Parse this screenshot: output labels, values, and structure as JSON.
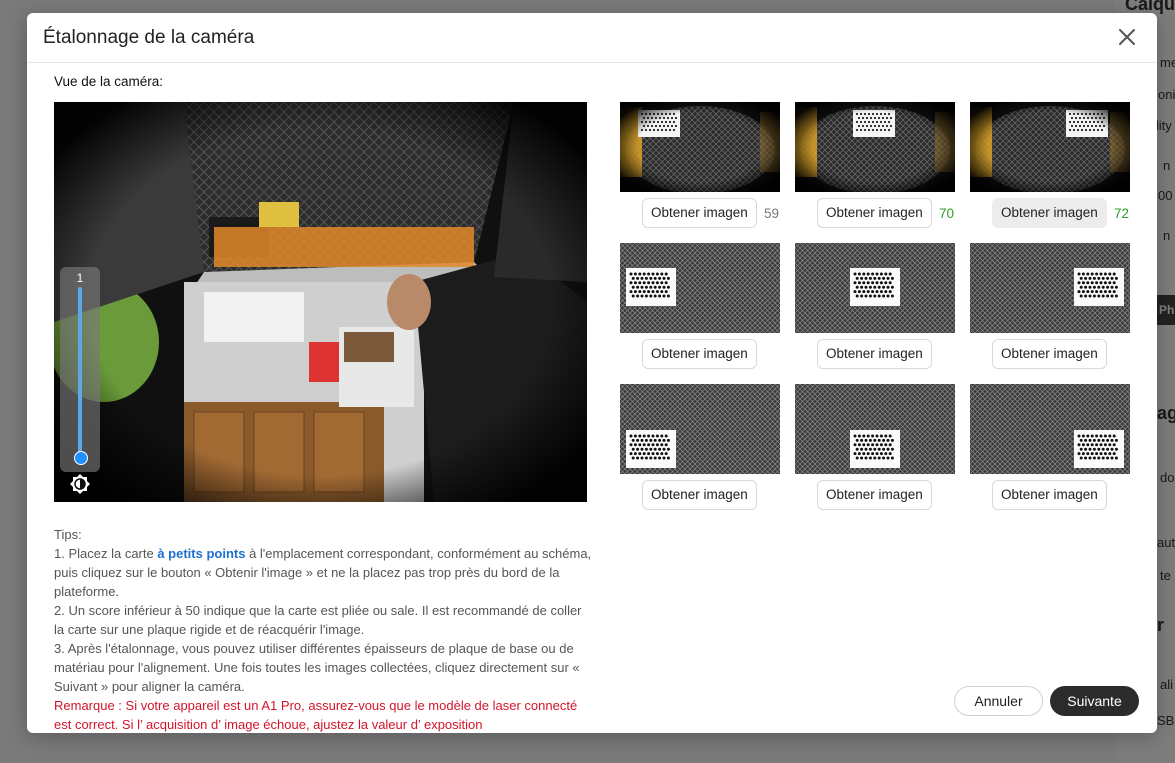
{
  "background": {
    "labels": [
      "Calque",
      "me",
      "oni",
      "ility",
      "n",
      "00",
      "n",
      "Ph",
      "ag",
      "do",
      "aut",
      "te",
      "r",
      "ali",
      "SB-"
    ]
  },
  "dialog": {
    "title": "Étalonnage de la caméra",
    "camera_label": "Vue de la caméra:",
    "exposure_value": "1",
    "capture_label": "Obtener imagen",
    "captures": [
      {
        "score": "59",
        "score_color": "#777777"
      },
      {
        "score": "70",
        "score_color": "#2a9d2a"
      },
      {
        "score": "72",
        "score_color": "#2a9d2a"
      },
      {
        "score": ""
      },
      {
        "score": ""
      },
      {
        "score": ""
      },
      {
        "score": ""
      },
      {
        "score": ""
      },
      {
        "score": ""
      }
    ],
    "tips": {
      "heading": "Tips:",
      "tip1_a": "1. Placez la carte ",
      "tip1_link": "à petits points",
      "tip1_b": " à l'emplacement correspondant, conformément au schéma, puis cliquez sur le bouton « Obtenir l'image » et ne la placez pas trop près du bord de la plateforme.",
      "tip2": "2. Un score inférieur à 50 indique que la carte est pliée ou sale. Il est recommandé de coller la carte sur une plaque rigide et de réacquérir l'image.",
      "tip3": "3. Après l'étalonnage, vous pouvez utiliser différentes épaisseurs de plaque de base ou de matériau pour l'alignement. Une fois toutes les images collectées, cliquez directement sur « Suivant » pour aligner la caméra.",
      "note": "Remarque : Si votre appareil est un A1 Pro, assurez-vous que le modèle de laser connecté est correct. Si l’ acquisition d’ image échoue, ajustez la valeur d’ exposition"
    },
    "cancel_label": "Annuler",
    "next_label": "Suivante"
  },
  "colors": {
    "accent_link": "#1f6fd1",
    "warning": "#d4142b",
    "score_good": "#2a9d2a",
    "primary_button": "#2b2b2b"
  }
}
